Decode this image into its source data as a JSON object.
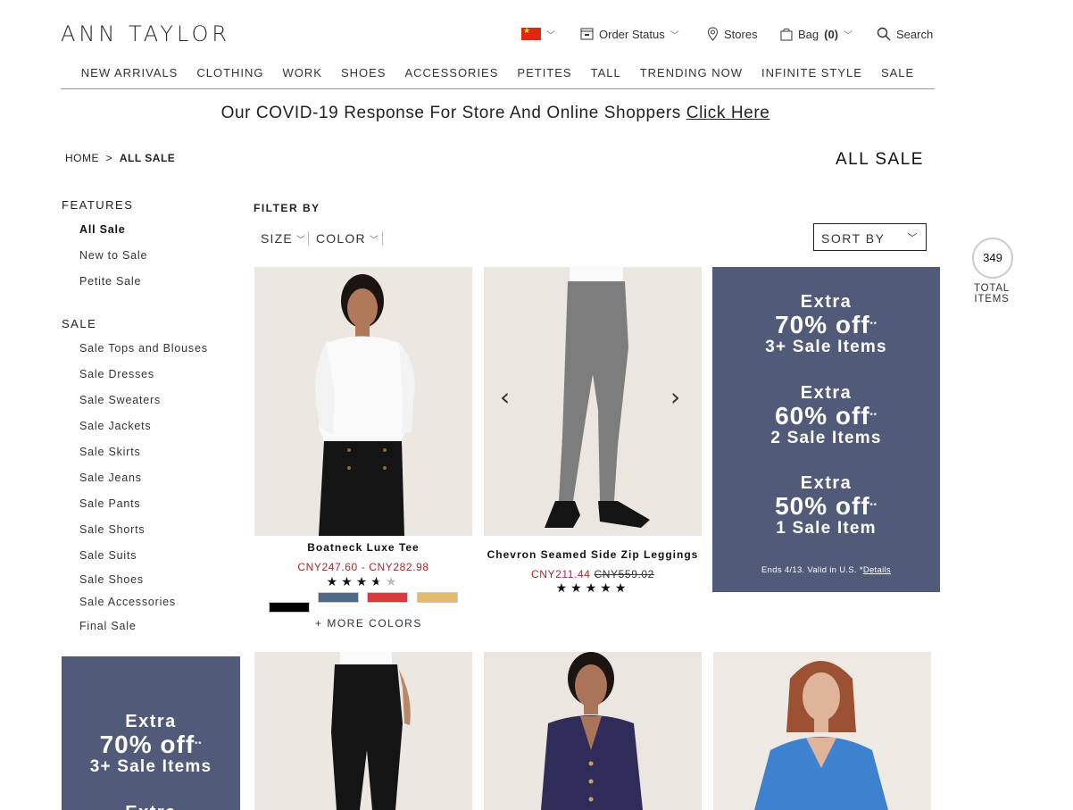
{
  "brand": "ANN TAYLOR",
  "utility": {
    "order_status": "Order Status",
    "stores": "Stores",
    "bag": "Bag",
    "bag_count": "(0)",
    "search": "Search"
  },
  "nav": [
    "NEW ARRIVALS",
    "CLOTHING",
    "WORK",
    "SHOES",
    "ACCESSORIES",
    "PETITES",
    "TALL",
    "TRENDING NOW",
    "INFINITE STYLE",
    "SALE"
  ],
  "banner": {
    "text": "Our COVID-19 Response For Store And Online Shoppers",
    "link": "Click Here"
  },
  "breadcrumb": {
    "home": "HOME",
    "sep": ">",
    "current": "ALL SALE"
  },
  "page_title": "ALL SALE",
  "sidebar": {
    "features_title": "FEATURES",
    "features": [
      "All Sale",
      "New to Sale",
      "Petite Sale"
    ],
    "sale_title": "SALE",
    "sale": [
      "Sale Tops and Blouses",
      "Sale Dresses",
      "Sale Sweaters",
      "Sale Jackets",
      "Sale Skirts",
      "Sale Jeans",
      "Sale Pants",
      "Sale Shorts",
      "Sale Suits",
      "Sale Shoes",
      "Sale Accessories",
      "Final Sale"
    ]
  },
  "filters": {
    "label": "FILTER BY",
    "size": "SIZE",
    "color": "COLOR",
    "sort": "SORT BY"
  },
  "total": {
    "count": "349",
    "label": "TOTAL ITEMS"
  },
  "products": [
    {
      "name": "Boatneck Luxe Tee",
      "price": "CNY247.60 - CNY282.98",
      "stars": "★★★★★",
      "rating": 3.5,
      "more": "+ MORE COLORS",
      "swatches": [
        "#000000",
        "#4f6a86",
        "#d93a3e",
        "#e1bb6b"
      ]
    },
    {
      "name": "Chevron Seamed Side Zip Leggings",
      "price": "CNY211.44",
      "was": "CNY559.02",
      "stars": "★★★★★",
      "rating": 5
    }
  ],
  "promo": {
    "extra": "Extra",
    "offers": [
      {
        "pct": "70% off",
        "items": "3+ Sale Items"
      },
      {
        "pct": "60% off",
        "items": "2 Sale Items"
      },
      {
        "pct": "50% off",
        "items": "1 Sale Item"
      }
    ],
    "sup": "**",
    "fine": "Ends 4/13. Valid in U.S. *",
    "details": "Details"
  },
  "colors": {
    "promo_bg": "#525a79",
    "sale_price": "#b0262b"
  }
}
